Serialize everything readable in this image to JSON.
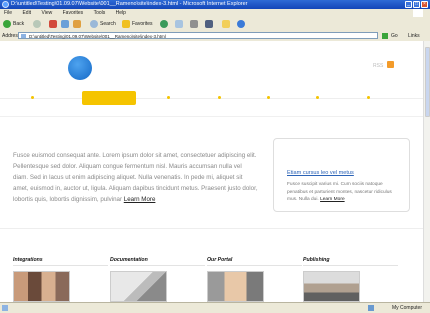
{
  "window": {
    "title": "D:\\untitled\\Testing\\01.09.07\\Website\\001__Rameno\\site\\index-3.html - Microsoft Internet Explorer"
  },
  "menu": [
    "File",
    "Edit",
    "View",
    "Favorites",
    "Tools",
    "Help"
  ],
  "toolbar": {
    "back_label": "Back",
    "search_label": "Search",
    "favorites_label": "Favorites"
  },
  "address": {
    "label": "Address",
    "value": "D:\\untitled\\Testing\\01.09.07\\Website\\001__Rameno\\site\\index-3.html",
    "go_label": "Go",
    "links_label": "Links"
  },
  "status": {
    "zone": "My Computer"
  },
  "page": {
    "rss_label": "RSS",
    "intro_text": "Fusce euismod consequat ante. Lorem ipsum dolor sit amet, consectetuer adipiscing elit. Pellentesque sed dolor. Aliquam congue fermentum nisl. Mauris accumsan nulla vel diam. Sed in lacus ut enim adipiscing aliquet. Nulla venenatis. In pede mi, aliquet sit amet, euismod in, auctor ut, ligula. Aliquam dapibus tincidunt metus. Praesent justo dolor, lobortis quis, lobortis dignissim, pulvinar",
    "intro_link": "Learn More",
    "callout": {
      "title": "Etiam cursus leo vel metus",
      "body": "Fusce suscipit varius mi. Cum sociis natoque penatibus et parturient montes, nascetur ridiculus mus. Nulla dui.",
      "link": "Learn More"
    },
    "categories": [
      {
        "label": "Integrations"
      },
      {
        "label": "Documentation"
      },
      {
        "label": "Our Portal"
      },
      {
        "label": "Publishing"
      }
    ]
  },
  "colors": {
    "accent": "#f5c400",
    "logo": "#1569c7",
    "link": "#2a62b6"
  }
}
